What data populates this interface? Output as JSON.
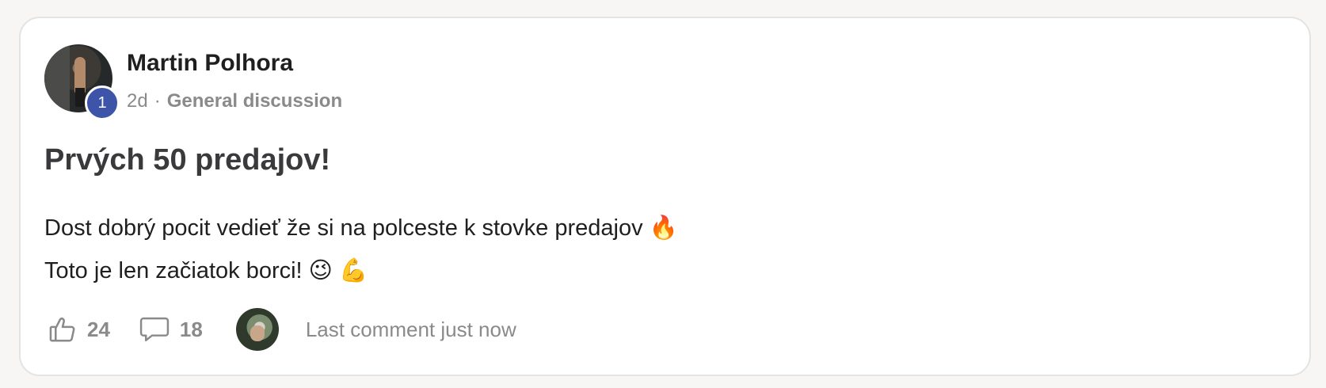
{
  "post": {
    "author_name": "Martin Polhora",
    "level": "1",
    "time_ago": "2d",
    "separator": "·",
    "category": "General discussion",
    "title": "Prvých 50 predajov!",
    "body_line_1": "Dost dobrý pocit vedieť že si na polceste k stovke predajov 🔥",
    "body_line_2": "Toto je len začiatok borci! 😉 💪"
  },
  "actions": {
    "like_count": "24",
    "comment_count": "18",
    "last_comment_text": "Last comment just now"
  },
  "colors": {
    "level_badge": "#3e54a8",
    "muted_text": "#8a8a8a",
    "title_text": "#3a3a3c",
    "card_border": "#e3e3e3"
  },
  "icons": {
    "like": "thumbs-up-icon",
    "comment": "comment-bubble-icon"
  }
}
